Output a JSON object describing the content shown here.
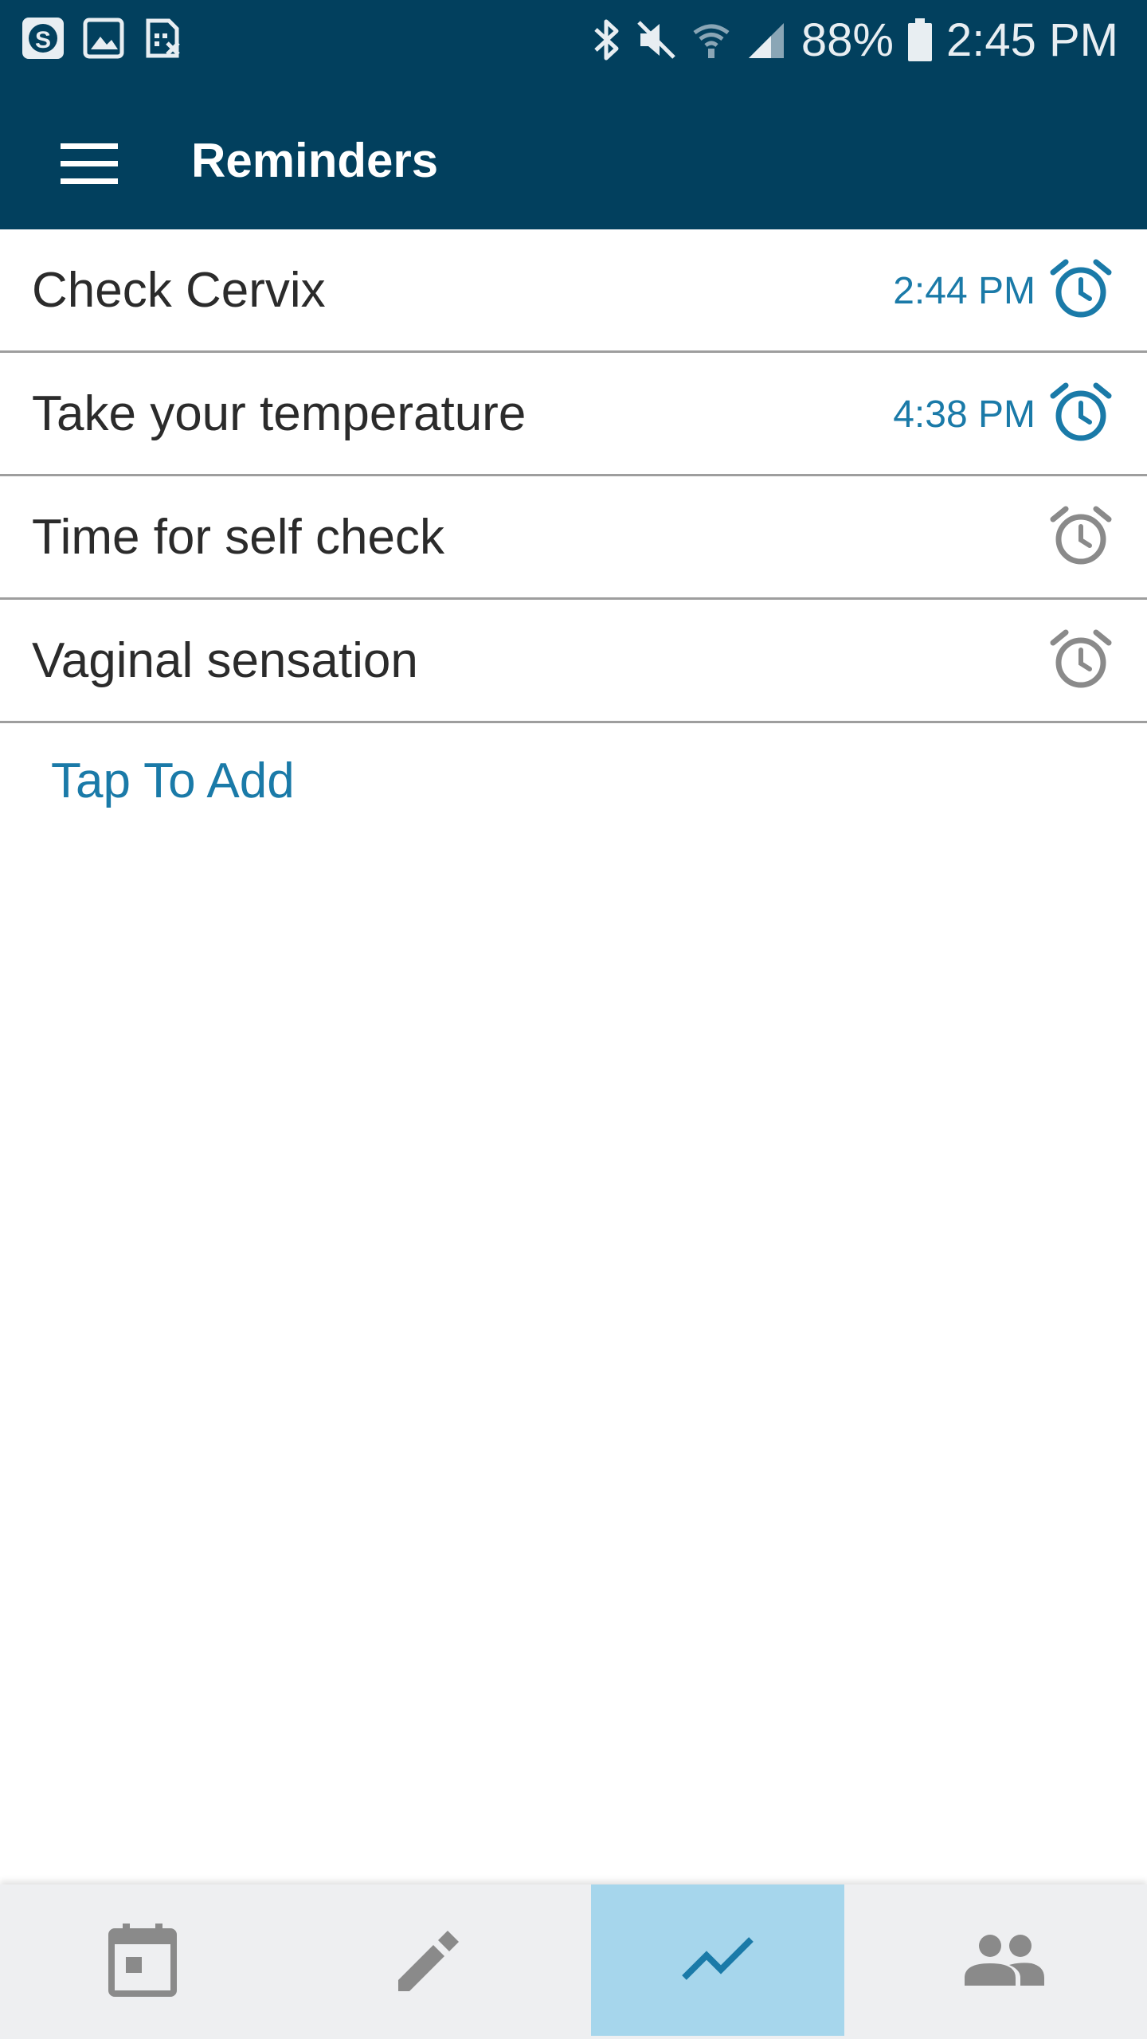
{
  "status_bar": {
    "battery_percent": "88%",
    "time": "2:45 PM",
    "left_icons": [
      "skype-icon",
      "gallery-icon",
      "sim-icon"
    ],
    "right_icons": [
      "bluetooth-icon",
      "mute-icon",
      "wifi-icon",
      "signal-icon",
      "battery-icon"
    ]
  },
  "app_bar": {
    "title": "Reminders",
    "menu_icon": "menu-icon"
  },
  "reminders": [
    {
      "label": "Check Cervix",
      "time": "2:44 PM",
      "active": true
    },
    {
      "label": "Take your temperature",
      "time": "4:38 PM",
      "active": true
    },
    {
      "label": "Time for self check",
      "time": "",
      "active": false
    },
    {
      "label": "Vaginal sensation",
      "time": "",
      "active": false
    }
  ],
  "add_label": "Tap To Add",
  "bottom_nav": {
    "tabs": [
      {
        "icon": "calendar-icon",
        "active": false
      },
      {
        "icon": "pencil-icon",
        "active": false
      },
      {
        "icon": "chart-icon",
        "active": true
      },
      {
        "icon": "people-icon",
        "active": false
      }
    ]
  },
  "colors": {
    "primary_dark": "#02405e",
    "accent": "#1a7aa8",
    "inactive_icon": "#8a8a8a",
    "active_tab_bg": "#a6d6ec",
    "nav_bg": "#eeeff1"
  }
}
